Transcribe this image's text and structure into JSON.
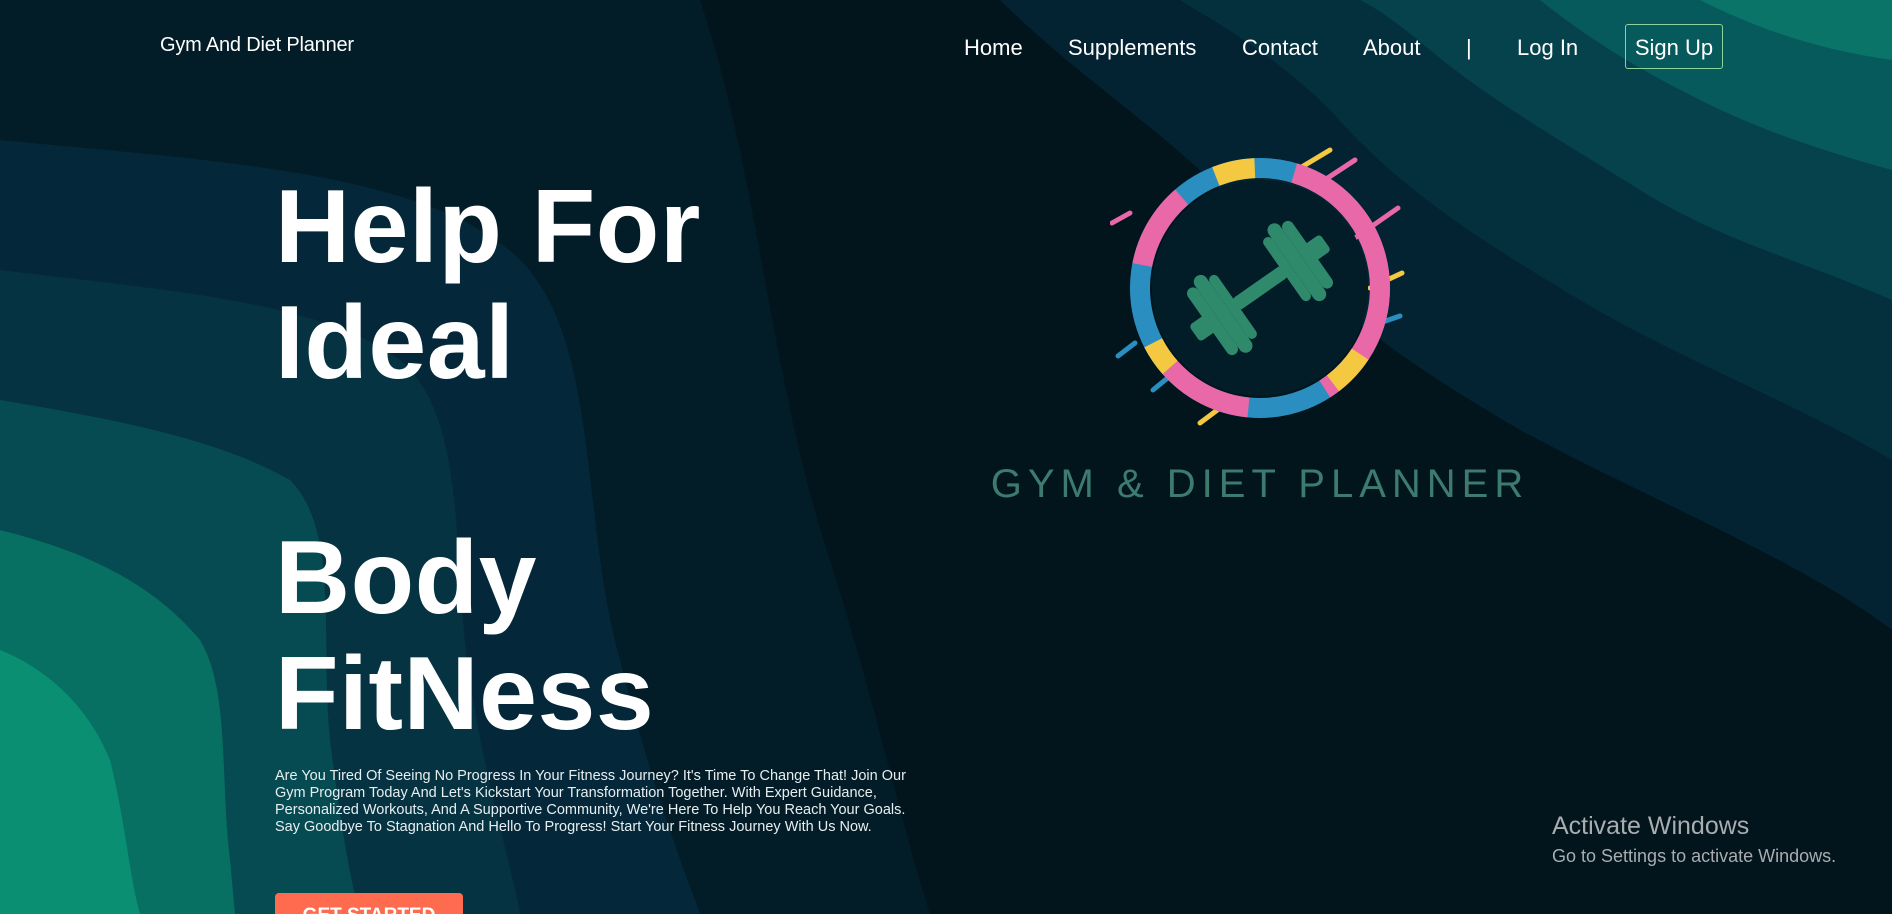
{
  "header": {
    "brand": "Gym And Diet Planner"
  },
  "nav": {
    "home": "Home",
    "supplements": "Supplements",
    "contact": "Contact",
    "about": "About",
    "separator": "|",
    "login": "Log In",
    "signup": "Sign Up"
  },
  "hero": {
    "title_line_1": "Help For Ideal",
    "title_line_2": "Body FitNess",
    "description": "Are You Tired Of Seeing No Progress In Your Fitness Journey? It's Time To Change That! Join Our Gym Program Today And Let's Kickstart Your Transformation Together. With Expert Guidance, Personalized Workouts, And A Supportive Community, We're Here To Help You Reach Your Goals. Say Goodbye To Stagnation And Hello To Progress! Start Your Fitness Journey With Us Now.",
    "cta_label": "GET STARTED"
  },
  "logo": {
    "icon": "dumbbell-ring-icon",
    "text": "GYM & DIET PLANNER"
  },
  "windows_watermark": {
    "title": "Activate Windows",
    "subtitle": "Go to Settings to activate Windows."
  },
  "colors": {
    "background_dark": "#031a24",
    "background_teal": "#0a8f73",
    "cta": "#ff6b4f",
    "signup_border": "#8ed39a",
    "logo_text": "#3d7a70",
    "ring_pink": "#e868a8",
    "ring_yellow": "#f5c842",
    "ring_blue": "#2a8fc0",
    "dumbbell": "#2f8a6c"
  }
}
